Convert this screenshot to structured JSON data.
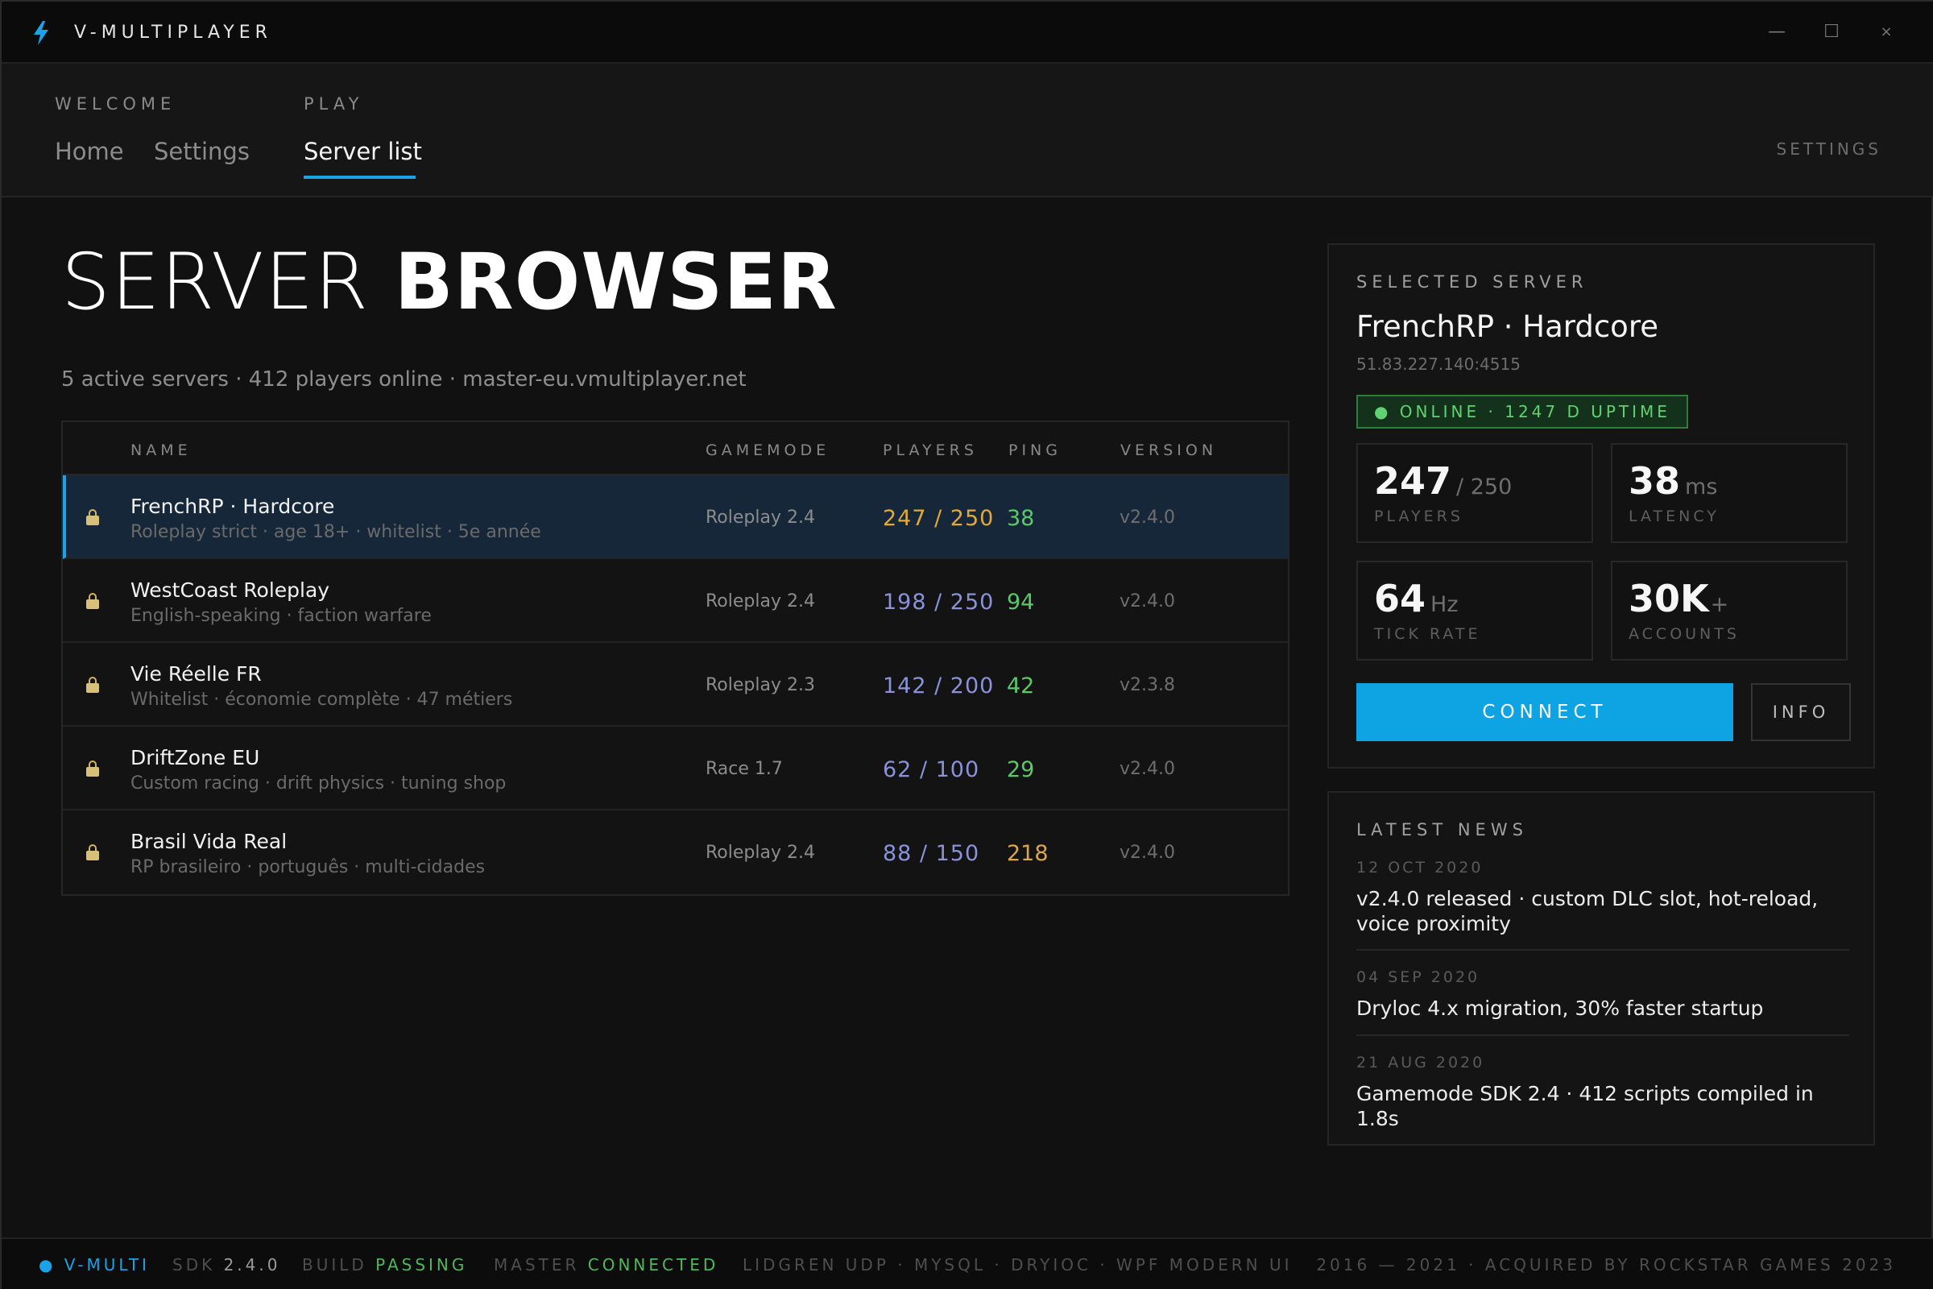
{
  "app": {
    "title": "V-MULTIPLAYER",
    "accent": "#1aa3e8"
  },
  "window": {
    "minimize": "—",
    "maximize": "☐",
    "close": "×"
  },
  "nav": {
    "welcome_label": "WELCOME",
    "play_label": "PLAY",
    "home": "Home",
    "settings": "Settings",
    "server_list": "Server list",
    "settings_right": "SETTINGS"
  },
  "main": {
    "title_light": "SERVER",
    "title_bold": "BROWSER",
    "subtitle": "5 active servers · 412 players online · master-eu.vmultiplayer.net"
  },
  "table": {
    "headers": {
      "name": "NAME",
      "gamemode": "GAMEMODE",
      "players": "PLAYERS",
      "ping": "PING",
      "version": "VERSION"
    },
    "rows": [
      {
        "name": "FrenchRP · Hardcore",
        "desc": "Roleplay strict · age 18+ · whitelist · 5e année",
        "mode": "Roleplay 2.4",
        "players": "247 / 250",
        "ping": "38",
        "version": "v2.4.0"
      },
      {
        "name": "WestCoast Roleplay",
        "desc": "English-speaking · faction warfare",
        "mode": "Roleplay 2.4",
        "players": "198 / 250",
        "ping": "94",
        "version": "v2.4.0"
      },
      {
        "name": "Vie Réelle FR",
        "desc": "Whitelist · économie complète · 47 métiers",
        "mode": "Roleplay 2.3",
        "players": "142 / 200",
        "ping": "42",
        "version": "v2.3.8"
      },
      {
        "name": "DriftZone EU",
        "desc": "Custom racing · drift physics · tuning shop",
        "mode": "Race 1.7",
        "players": "62 / 100",
        "ping": "29",
        "version": "v2.4.0"
      },
      {
        "name": "Brasil Vida Real",
        "desc": "RP brasileiro · português · multi-cidades",
        "mode": "Roleplay 2.4",
        "players": "88 / 150",
        "ping": "218",
        "version": "v2.4.0"
      }
    ]
  },
  "selected": {
    "label": "SELECTED SERVER",
    "name": "FrenchRP · Hardcore",
    "address": "51.83.227.140:4515",
    "status": "● ONLINE · 1247 D UPTIME",
    "stats": {
      "players_val": "247",
      "players_unit": "/ 250",
      "players_label": "PLAYERS",
      "latency_val": "38",
      "latency_unit": "ms",
      "latency_label": "LATENCY",
      "tick_val": "64",
      "tick_unit": "Hz",
      "tick_label": "TICK RATE",
      "accounts_val": "30K",
      "accounts_unit": "+",
      "accounts_label": "ACCOUNTS"
    },
    "connect": "CONNECT",
    "info": "INFO"
  },
  "news": {
    "label": "LATEST NEWS",
    "items": [
      {
        "date": "12 OCT 2020",
        "text": "v2.4.0 released · custom DLC slot, hot-reload, voice proximity"
      },
      {
        "date": "04 SEP 2020",
        "text": "Dryloc 4.x migration, 30% faster startup"
      },
      {
        "date": "21 AUG 2020",
        "text": "Gamemode SDK 2.4 · 412 scripts compiled in 1.8s"
      }
    ]
  },
  "statusbar": {
    "brand": "● V-MULTI",
    "sdk_label": "SDK",
    "sdk_value": "2.4.0",
    "build_label": "BUILD",
    "build_value": "PASSING",
    "master_label": "MASTER",
    "master_value": "CONNECTED",
    "stack": "LIDGREN UDP · MYSQL · DRYIOC · WPF MODERN UI",
    "copyright": "2016 — 2021 · ACQUIRED BY ROCKSTAR GAMES 2023"
  }
}
